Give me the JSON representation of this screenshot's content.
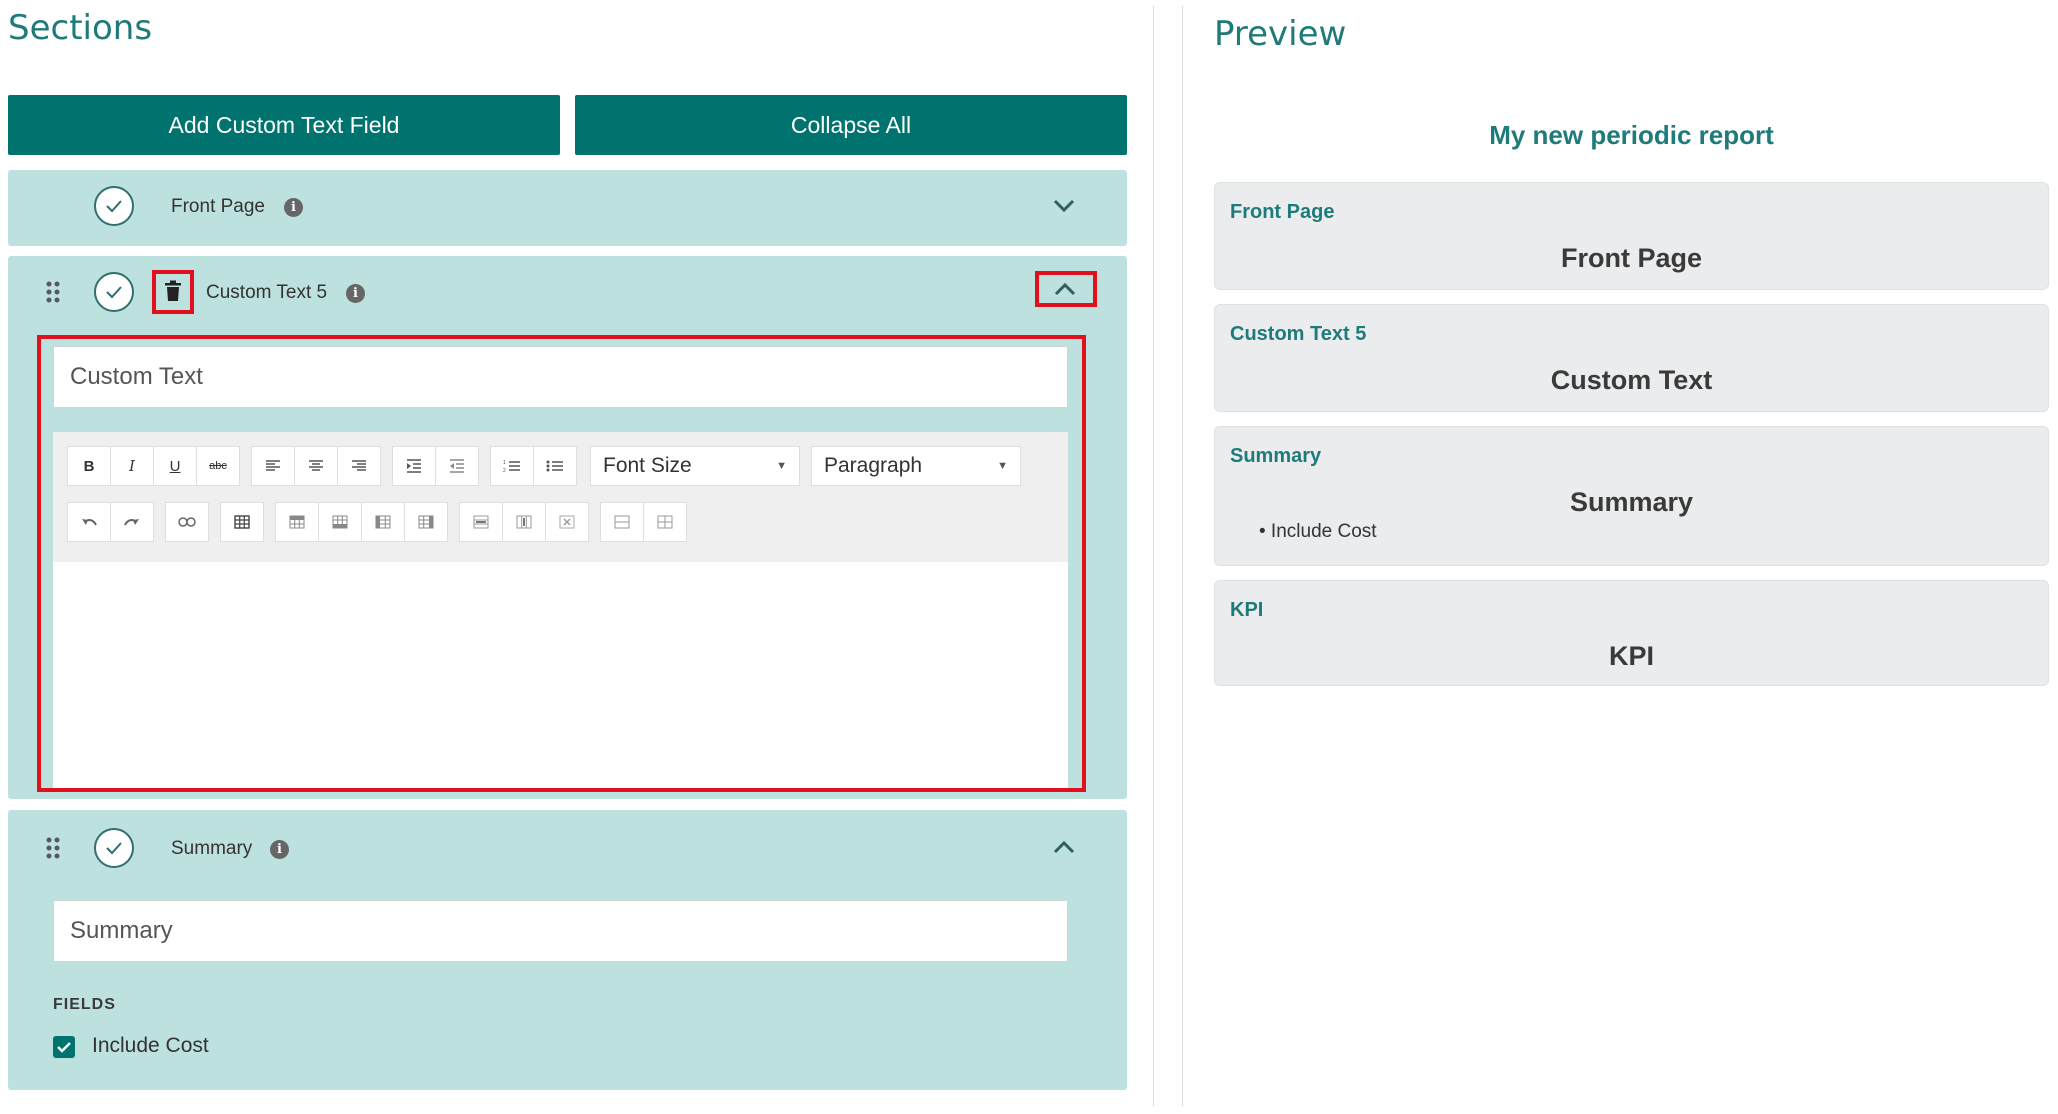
{
  "left": {
    "heading": "Sections",
    "add_button": "Add Custom Text Field",
    "collapse_button": "Collapse All",
    "front_page": {
      "label": "Front Page"
    },
    "custom_text": {
      "label": "Custom Text 5",
      "title_value": "Custom Text",
      "font_size_label": "Font Size",
      "paragraph_label": "Paragraph"
    },
    "summary": {
      "label": "Summary",
      "title_value": "Summary",
      "fields_label": "FIELDS",
      "include_cost": "Include Cost"
    }
  },
  "preview": {
    "heading": "Preview",
    "report_title": "My new periodic report",
    "cards": [
      {
        "title": "Front Page",
        "heading": "Front Page"
      },
      {
        "title": "Custom Text 5",
        "heading": "Custom Text"
      },
      {
        "title": "Summary",
        "heading": "Summary",
        "bullet": "• Include Cost"
      },
      {
        "title": "KPI",
        "heading": "KPI"
      }
    ]
  },
  "colors": {
    "accent": "#00736e",
    "panel": "#bde1df",
    "highlight": "#e0101c",
    "teal_text": "#1e7b7a"
  }
}
